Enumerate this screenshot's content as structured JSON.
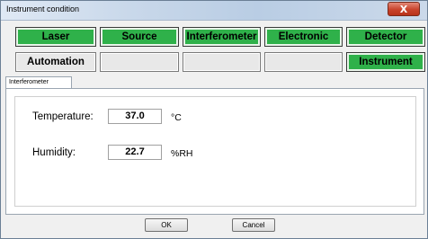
{
  "window": {
    "title": "Instrument condition",
    "close_label": "X"
  },
  "tiles": {
    "row1": [
      {
        "label": "Laser",
        "active": true
      },
      {
        "label": "Source",
        "active": true
      },
      {
        "label": "Interferometer",
        "active": true
      },
      {
        "label": "Electronic",
        "active": true
      },
      {
        "label": "Detector",
        "active": true
      }
    ],
    "row2": [
      {
        "label": "Automation",
        "active": false
      },
      {
        "label": "",
        "active": false
      },
      {
        "label": "",
        "active": false
      },
      {
        "label": "",
        "active": false
      },
      {
        "label": "Instrument",
        "active": true
      }
    ]
  },
  "tab": {
    "label": "Interferometer"
  },
  "readings": {
    "temperature": {
      "label": "Temperature:",
      "value": "37.0",
      "unit": "°C"
    },
    "humidity": {
      "label": "Humidity:",
      "value": "22.7",
      "unit": "%RH"
    }
  },
  "buttons": {
    "ok": "OK",
    "cancel": "Cancel"
  },
  "colors": {
    "active_tile": "#2fb14a",
    "inactive_tile": "#e8e8e8"
  }
}
